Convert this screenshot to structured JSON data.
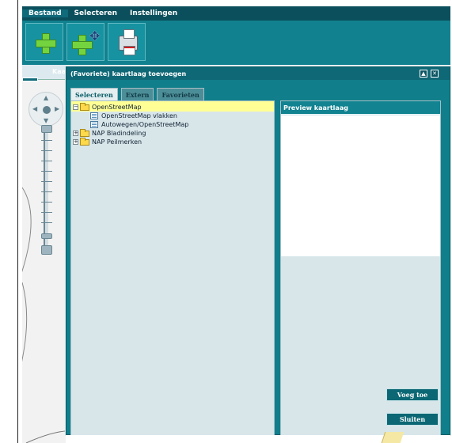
{
  "menu": {
    "items": [
      {
        "label": "Bestand",
        "active": true
      },
      {
        "label": "Selecteren",
        "active": false
      },
      {
        "label": "Instellingen",
        "active": false
      }
    ]
  },
  "toolbar": {
    "add_icon": "plus-icon",
    "add_move_icon": "plus-move-icon",
    "print_icon": "printer-icon"
  },
  "map": {
    "side_tab_label": "Kaartl",
    "pan_icon": "pan-control-icon",
    "zoom_icon": "zoom-slider-icon"
  },
  "dialog": {
    "title": "(Favoriete) kaartlaag toevoegen",
    "minimize_symbol": "▲",
    "close_symbol": "✕",
    "tabs": [
      {
        "label": "Selecteren",
        "active": true
      },
      {
        "label": "Extern",
        "active": false
      },
      {
        "label": "Favorieten",
        "active": false
      }
    ],
    "tree": [
      {
        "label": "OpenStreetMap",
        "expanded": true,
        "icon": "folder-icon",
        "selected": true
      },
      {
        "label": "OpenStreetMap vlakken",
        "icon": "layer-icon"
      },
      {
        "label": "Autowegen/OpenStreetMap",
        "icon": "layer-icon"
      },
      {
        "label": "NAP Bladindeling",
        "expanded": false,
        "icon": "folder-icon"
      },
      {
        "label": "NAP Peilmerken",
        "expanded": false,
        "icon": "folder-icon"
      }
    ],
    "preview_title": "Preview kaartlaag",
    "add_button": "Voeg toe",
    "close_button": "Sluiten"
  },
  "colors": {
    "menu": "#0b4f5c",
    "toolbar": "#11818f",
    "dialog": "#117e8b",
    "selected": "#ffff95"
  }
}
